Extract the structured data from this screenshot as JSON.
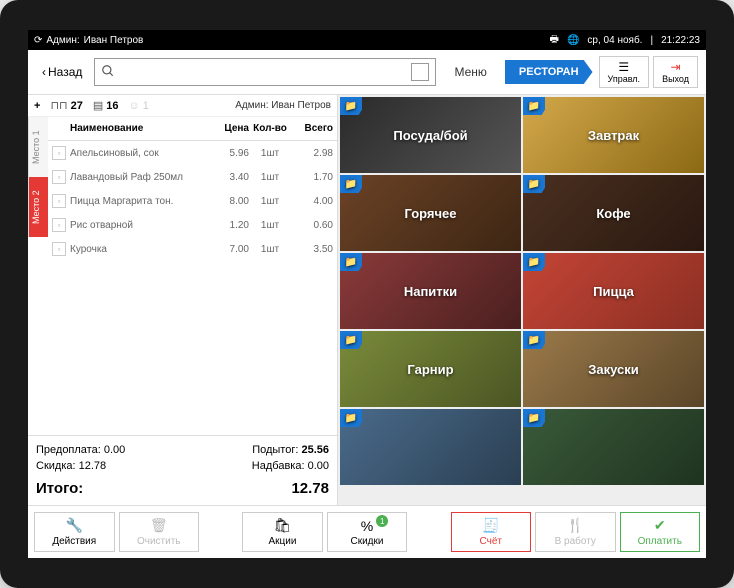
{
  "status": {
    "admin_prefix": "Админ:",
    "admin_name": "Иван Петров",
    "date": "ср, 04 нояб.",
    "time": "21:22:23"
  },
  "topbar": {
    "back": "Назад",
    "menu": "Меню",
    "restaurant": "РЕСТОРАН",
    "manage": "Управл.",
    "exit": "Выход"
  },
  "order_header": {
    "table": "27",
    "guests": "16",
    "person": "1",
    "admin": "Админ: Иван Петров"
  },
  "places": [
    {
      "label": "Место 1"
    },
    {
      "label": "Место 2"
    }
  ],
  "columns": {
    "name": "Наименование",
    "price": "Цена",
    "qty": "Кол-во",
    "total": "Всего"
  },
  "items": [
    {
      "name": "Апельсиновый, сок",
      "price": "5.96",
      "qty": "1шт",
      "total": "2.98"
    },
    {
      "name": "Лавандовый Раф 250мл",
      "price": "3.40",
      "qty": "1шт",
      "total": "1.70"
    },
    {
      "name": "Пицца Маргарита тон.",
      "price": "8.00",
      "qty": "1шт",
      "total": "4.00"
    },
    {
      "name": "Рис отварной",
      "price": "1.20",
      "qty": "1шт",
      "total": "0.60"
    },
    {
      "name": "Курочка",
      "price": "7.00",
      "qty": "1шт",
      "total": "3.50"
    }
  ],
  "totals": {
    "prepay_label": "Предоплата:",
    "prepay": "0.00",
    "subtotal_label": "Подытог:",
    "subtotal": "25.56",
    "discount_label": "Скидка:",
    "discount": "12.78",
    "surcharge_label": "Надбавка:",
    "surcharge": "0.00",
    "total_label": "Итого:",
    "total": "12.78"
  },
  "categories": [
    {
      "label": "Посуда/бой"
    },
    {
      "label": "Завтрак"
    },
    {
      "label": "Горячее"
    },
    {
      "label": "Кофе"
    },
    {
      "label": "Напитки"
    },
    {
      "label": "Пицца"
    },
    {
      "label": "Гарнир"
    },
    {
      "label": "Закуски"
    },
    {
      "label": ""
    },
    {
      "label": ""
    }
  ],
  "bottom": {
    "actions": "Действия",
    "clear": "Очистить",
    "promo": "Акции",
    "discounts": "Скидки",
    "bill": "Счёт",
    "towork": "В работу",
    "pay": "Оплатить",
    "discount_badge": "1"
  }
}
